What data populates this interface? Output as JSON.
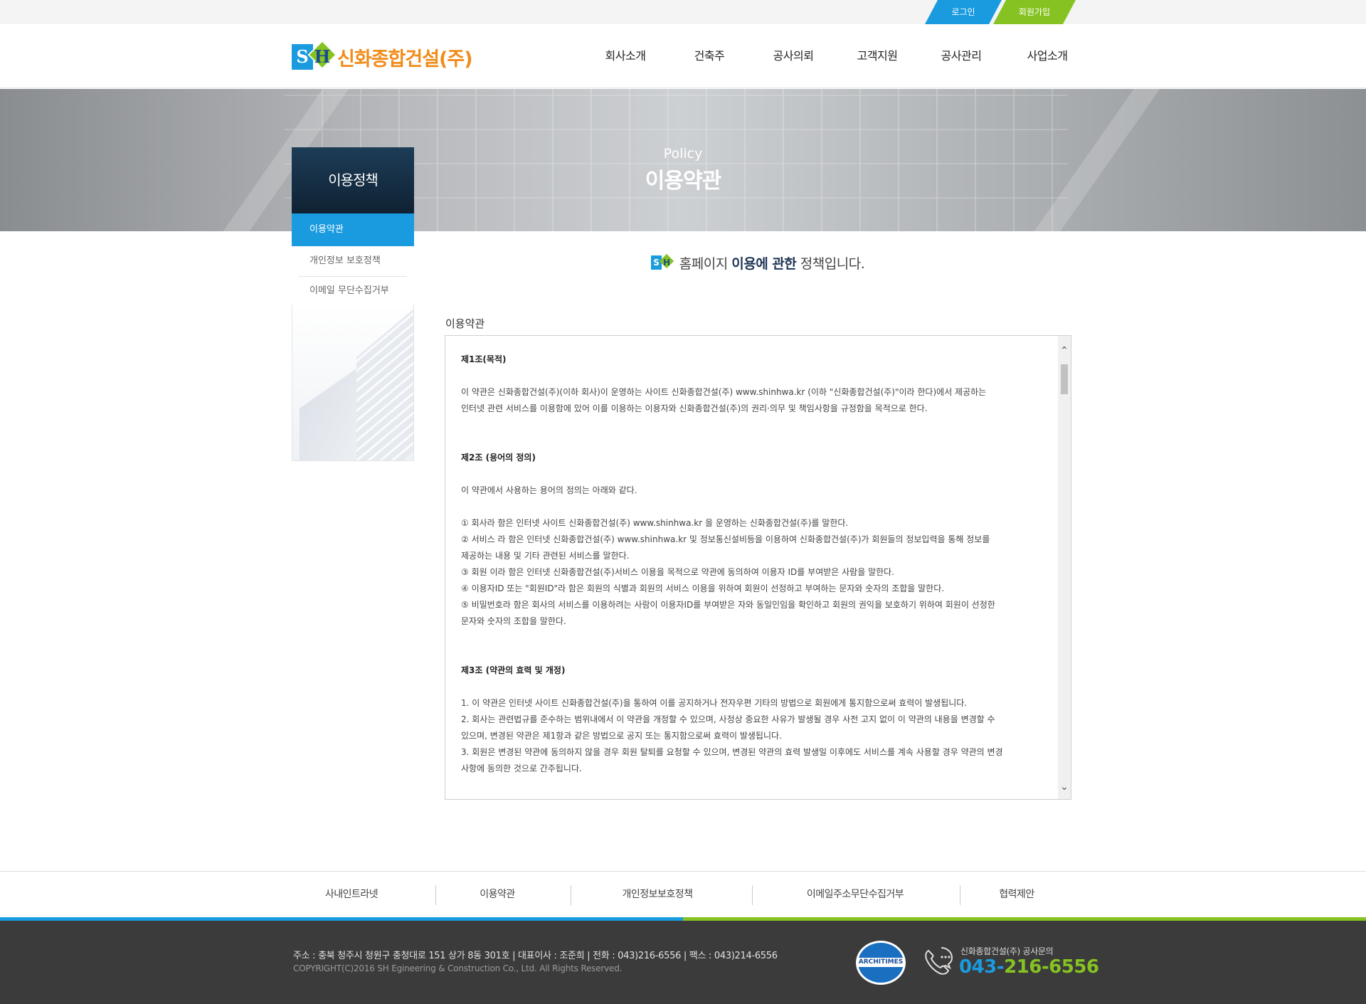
{
  "topbar": {
    "login": "로그인",
    "join": "회원가입"
  },
  "brand": {
    "logo_s": "S",
    "logo_h": "H",
    "name": "신화종합건설(주)"
  },
  "nav": [
    "회사소개",
    "건축주",
    "공사의뢰",
    "고객지원",
    "공사관리",
    "사업소개"
  ],
  "banner": {
    "subtitle": "Policy",
    "title": "이용약관"
  },
  "side": {
    "title": "이용정책",
    "items": [
      "이용약관",
      "개인정보 보호정책",
      "이메일 무단수집거부"
    ]
  },
  "lead": {
    "pre": "홈페이지 ",
    "strong": "이용에 관한",
    "post": " 정책입니다."
  },
  "terms": {
    "label": "이용약관",
    "art1_title": "제1조(목적)",
    "art1_l1": "이 약관은 신화종합건설(주)(이하 회사)이 운영하는 사이트 신화종합건설(주) www.shinhwa.kr (이하 \"신화종합건설(주)\"이라 한다)에서 제공하는",
    "art1_l2": "인터넷 관련 서비스를 이용함에 있어 이를 이용하는 이용자와 신화종합건설(주)의 권리·의무 및 책임사항을 규정함을 목적으로 한다.",
    "art2_title": "제2조 (용어의 정의)",
    "art2_intro": "이 약관에서 사용하는 용어의 정의는 아래와 같다.",
    "art2_i1": "① 회사라 함은 인터넷 사이트 신화종합건설(주) www.shinhwa.kr 을 운영하는 신화종합건설(주)를 말한다.",
    "art2_i2a": "② 서비스 라 함은 인터넷 신화종합건설(주) www.shinhwa.kr 및 정보통신설비등을 이용하여 신화종합건설(주)가 회원들의 정보입력을 통해 정보를",
    "art2_i2b": " 제공하는 내용 및 기타 관련된 서비스를 말한다.",
    "art2_i3": "③ 회원 이라 함은 인터넷 신화종합건설(주)서비스 이용을 목적으로 약관에 동의하여 이용자 ID를 부여받은 사람을 말한다.",
    "art2_i4": "④ 이용자ID 또는 \"회원ID\"라 함은 회원의 식별과 회원의 서비스 이용을 위하여 회원이 선정하고 부여하는 문자와 숫자의 조합을 말한다.",
    "art2_i5a": "⑤ 비밀번호라 함은 회사의 서비스를 이용하려는 사람이 이용자ID를 부여받은 자와 동일인임을 확인하고 회원의 권익을 보호하기 위하여 회원이 선정한",
    "art2_i5b": "문자와 숫자의 조합을 말한다.",
    "art3_title": "제3조 (약관의 효력 및 개정)",
    "art3_i1": "1. 이 약관은 인터넷 사이트 신화종합건설(주)을 통하여 이를 공지하거나 전자우편 기타의 방법으로 회원에게 통지함으로써 효력이 발생됩니다.",
    "art3_i2a": "2. 회사는 관련법규를 준수하는 범위내에서 이 약관을 개정할 수 있으며, 사정상 중요한 사유가 발생될 경우 사전 고지 없이 이 약관의 내용을 변경할 수",
    "art3_i2b": "있으며, 변경된 약관은 제1항과 같은 방법으로 공지 또는 통지함으로써 효력이 발생됩니다.",
    "art3_i3a": "3. 회원은 변경된 약관에 동의하지 않을 경우 회원 탈퇴를 요청할 수 있으며, 변경된 약관의 효력 발생일 이후에도 서비스를 계속 사용할 경우 약관의 변경",
    "art3_i3b": "사항에 동의한 것으로 간주됩니다."
  },
  "footer_nav": [
    "사내인트라넷",
    "이용약관",
    "개인정보보호정책",
    "이메일주소무단수집거부",
    "협력제안"
  ],
  "footer": {
    "address": "주소 : 충북 청주시 청원구 충청대로 151 상가 8동 301호  |  대표이사 : 조준희  |  전화 : 043)216-6556  |  팩스 : 043)214-6556",
    "copyright": "COPYRIGHT(C)2016  SH Egineering & Construction  Co., Ltd. All Rights Reserved.",
    "seal_text": "ARCHITIMES",
    "contact_label": "신화종합건설(주) 공사문의",
    "contact_a": "043-",
    "contact_b": "216-6556"
  },
  "colors": {
    "blue": "#1a9be0",
    "green": "#86c322",
    "orange": "#f08c1a",
    "navy": "#1d3c57"
  }
}
